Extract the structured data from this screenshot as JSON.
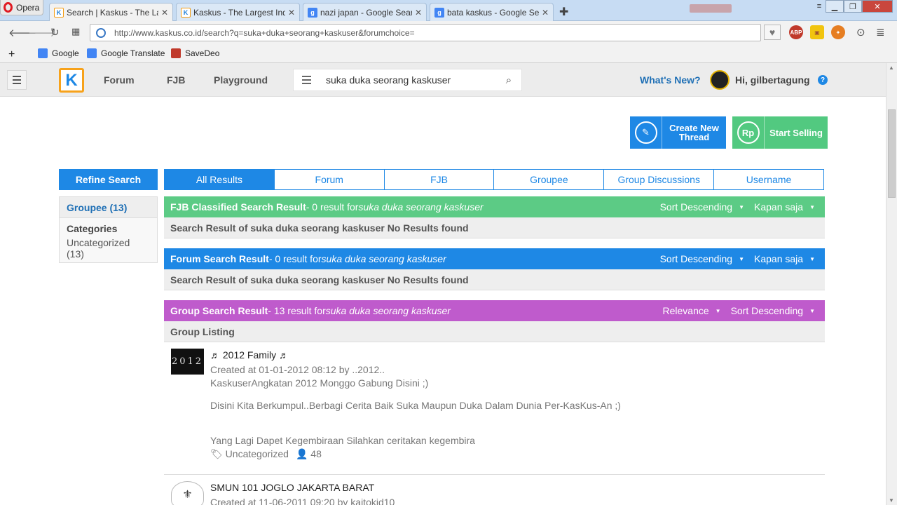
{
  "browser": {
    "opera_label": "Opera",
    "tabs": [
      {
        "title": "Search | Kaskus - The Largest",
        "icon": "kaskus-icon",
        "active": true
      },
      {
        "title": "Kaskus - The Largest Indonesian",
        "icon": "kaskus-icon",
        "active": false
      },
      {
        "title": "nazi japan - Google Search",
        "icon": "google-icon",
        "active": false
      },
      {
        "title": "bata kaskus - Google Search",
        "icon": "google-icon",
        "active": false
      }
    ],
    "url": "http://www.kaskus.co.id/search?q=suka+duka+seorang+kaskuser&forumchoice=",
    "bookmarks": [
      {
        "label": "Google",
        "icon": "google-icon",
        "color": "#4285f4"
      },
      {
        "label": "Google Translate",
        "icon": "translate-icon",
        "color": "#4285f4"
      },
      {
        "label": "SaveDeo",
        "icon": "savedeo-icon",
        "color": "#c0392b"
      }
    ],
    "ext_abp": "ABP"
  },
  "header": {
    "logo": "K",
    "nav": [
      "Forum",
      "FJB",
      "Playground"
    ],
    "search_value": "suka duka seorang kaskuser",
    "whats_new": "What's New?",
    "greeting": "Hi, gilbertagung",
    "help": "?"
  },
  "actions": {
    "create_thread": "Create New Thread",
    "start_selling": "Start Selling",
    "rp": "Rp"
  },
  "sidebar": {
    "refine": "Refine Search",
    "groupee": "Groupee (13)",
    "categories": "Categories",
    "category_item": "Uncategorized (13)"
  },
  "result_tabs": [
    "All Results",
    "Forum",
    "FJB",
    "Groupee",
    "Group Discussions",
    "Username"
  ],
  "sections": {
    "fjb": {
      "title": "FJB Classified Search Result",
      "count_text": " - 0 result for ",
      "query": "suka duka seorang kaskuser",
      "sort": "Sort Descending",
      "time": "Kapan saja",
      "no_results": "Search Result of suka duka seorang kaskuser No Results found",
      "color": "#5ccb85"
    },
    "forum": {
      "title": "Forum Search Result",
      "count_text": " - 0 result for ",
      "query": "suka duka seorang kaskuser",
      "sort": "Sort Descending",
      "time": "Kapan saja",
      "no_results": "Search Result of suka duka seorang kaskuser No Results found",
      "color": "#1e88e5"
    },
    "group": {
      "title": "Group Search Result",
      "count_text": " - 13 result for ",
      "query": "suka duka seorang kaskuser",
      "relevance": "Relevance",
      "sort": "Sort Descending",
      "color": "#bf5bcc",
      "listing_title": "Group Listing"
    }
  },
  "groups": [
    {
      "title": "♬ 2012 Family ♬",
      "thumb_text": "2012",
      "created": "Created at 01-01-2012 08:12 by ..2012..",
      "line1": "KaskuserAngkatan 2012 Monggo Gabung Disini ;)",
      "line2": "Disini Kita Berkumpul..Berbagi Cerita Baik Suka Maupun Duka Dalam Dunia Per-KasKus-An ;)",
      "line3": "Yang Lagi Dapet Kegembiraan Silahkan ceritakan kegembira",
      "category": "Uncategorized",
      "members": "48"
    },
    {
      "title": "SMUN 101 JOGLO JAKARTA BARAT",
      "created": "Created at 11-06-2011 09:20 by kaitokid10"
    }
  ]
}
